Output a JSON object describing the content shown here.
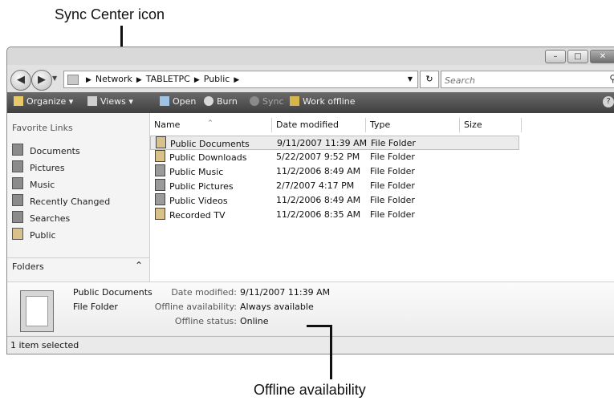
{
  "annotations": {
    "top": "Sync Center icon",
    "bottom": "Offline availability"
  },
  "window": {
    "buttons": {
      "minimize": "–",
      "maximize": "□",
      "close": "✕"
    }
  },
  "address": {
    "crumbs": [
      "Network",
      "TABLETPC",
      "Public"
    ],
    "search_placeholder": "Search"
  },
  "toolbar": {
    "organize": "Organize ▾",
    "views": "Views ▾",
    "open": "Open",
    "burn": "Burn",
    "sync": "Sync",
    "work_offline": "Work offline",
    "help": "?"
  },
  "nav": {
    "title": "Favorite Links",
    "items": [
      "Documents",
      "Pictures",
      "Music",
      "Recently Changed",
      "Searches",
      "Public"
    ],
    "folders": "Folders"
  },
  "columns": [
    "Name",
    "Date modified",
    "Type",
    "Size"
  ],
  "files": [
    {
      "name": "Public Documents",
      "date": "9/11/2007 11:39 AM",
      "type": "File Folder"
    },
    {
      "name": "Public Downloads",
      "date": "5/22/2007 9:52 PM",
      "type": "File Folder"
    },
    {
      "name": "Public Music",
      "date": "11/2/2006 8:49 AM",
      "type": "File Folder"
    },
    {
      "name": "Public Pictures",
      "date": "2/7/2007 4:17 PM",
      "type": "File Folder"
    },
    {
      "name": "Public Videos",
      "date": "11/2/2006 8:49 AM",
      "type": "File Folder"
    },
    {
      "name": "Recorded TV",
      "date": "11/2/2006 8:35 AM",
      "type": "File Folder"
    }
  ],
  "details": {
    "name": "Public Documents",
    "kind": "File Folder",
    "date_label": "Date modified:",
    "date_value": "9/11/2007 11:39 AM",
    "offline_label": "Offline availability:",
    "offline_value": "Always available",
    "status_label": "Offline status:",
    "status_value": "Online"
  },
  "status": "1 item selected"
}
